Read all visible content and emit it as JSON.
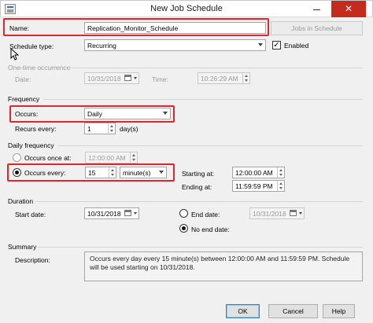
{
  "window": {
    "title": "New Job Schedule",
    "minimize_glyph": "",
    "close_glyph": "✕",
    "app_icon": "job-schedule-icon"
  },
  "name": {
    "label": "Name:",
    "value": "Replication_Monitor_Schedule",
    "jobs_button": "Jobs in Schedule"
  },
  "schedule_type": {
    "label": "Schedule type:",
    "value": "Recurring",
    "enabled_label": "Enabled",
    "enabled": true
  },
  "one_time": {
    "section": "One-time occurrence",
    "date_label": "Date:",
    "date_value": "10/31/2018",
    "time_label": "Time:",
    "time_value": "10:26:29 AM"
  },
  "frequency": {
    "section": "Frequency",
    "occurs_label": "Occurs:",
    "occurs_value": "Daily",
    "recurs_label": "Recurs every:",
    "recurs_value": "1",
    "recurs_unit": "day(s)"
  },
  "daily_frequency": {
    "section": "Daily frequency",
    "once_label": "Occurs once at:",
    "once_value": "12:00:00 AM",
    "every_label": "Occurs every:",
    "every_value": "15",
    "every_unit": "minute(s)",
    "starting_label": "Starting at:",
    "starting_value": "12:00:00 AM",
    "ending_label": "Ending at:",
    "ending_value": "11:59:59 PM"
  },
  "duration": {
    "section": "Duration",
    "start_label": "Start date:",
    "start_value": "10/31/2018",
    "end_label": "End date:",
    "end_value": "10/31/2018",
    "no_end_label": "No end date:"
  },
  "summary": {
    "section": "Summary",
    "description_label": "Description:",
    "description": "Occurs every day every 15 minute(s) between 12:00:00 AM and 11:59:59 PM. Schedule will be used starting on 10/31/2018."
  },
  "buttons": {
    "ok": "OK",
    "cancel": "Cancel",
    "help": "Help"
  },
  "colors": {
    "highlight": "#e0262c",
    "close": "#c42b1c"
  }
}
